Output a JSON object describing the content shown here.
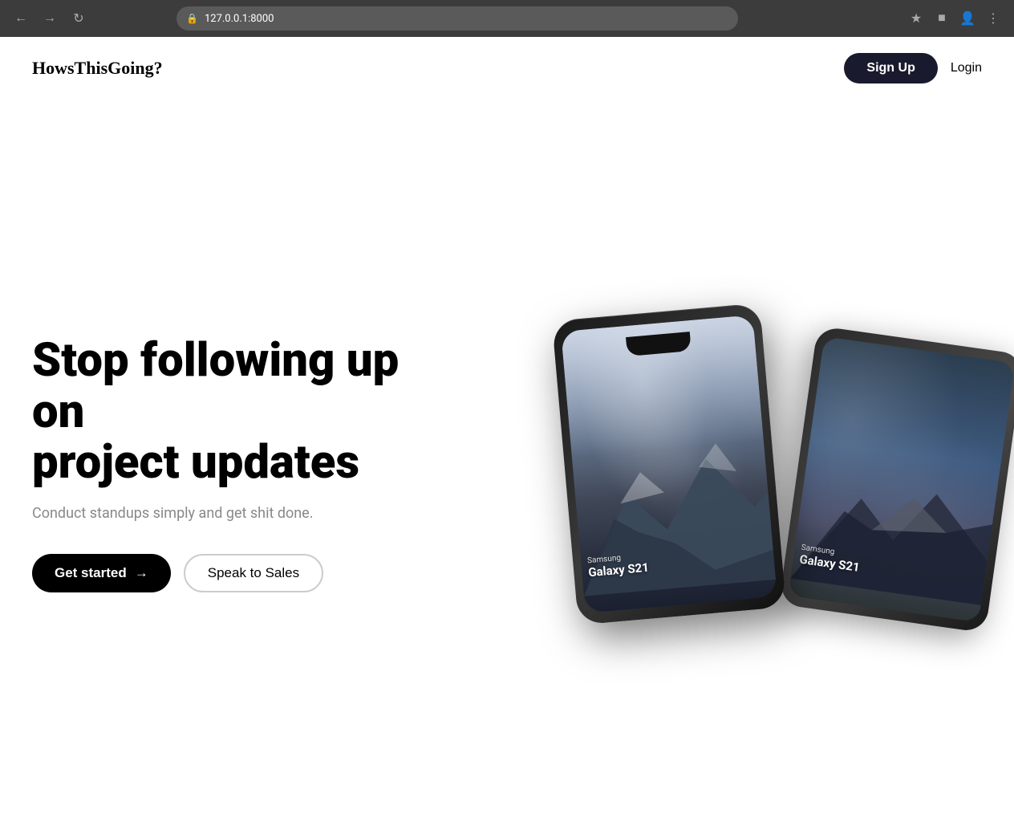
{
  "browser": {
    "url": "127.0.0.1:8000",
    "back_title": "Back",
    "forward_title": "Forward",
    "reload_title": "Reload"
  },
  "navbar": {
    "logo": "HowsThisGoing?",
    "signup_label": "Sign Up",
    "login_label": "Login"
  },
  "hero": {
    "title_line1": "Stop following up on",
    "title_line2": "project updates",
    "subtitle": "Conduct standups simply and get shit done.",
    "get_started_label": "Get started",
    "speak_sales_label": "Speak to Sales",
    "arrow": "→"
  },
  "phones": {
    "front": {
      "brand": "Samsung",
      "model": "Galaxy S21"
    },
    "back": {
      "brand": "Samsung",
      "model": "Galaxy S21"
    }
  }
}
